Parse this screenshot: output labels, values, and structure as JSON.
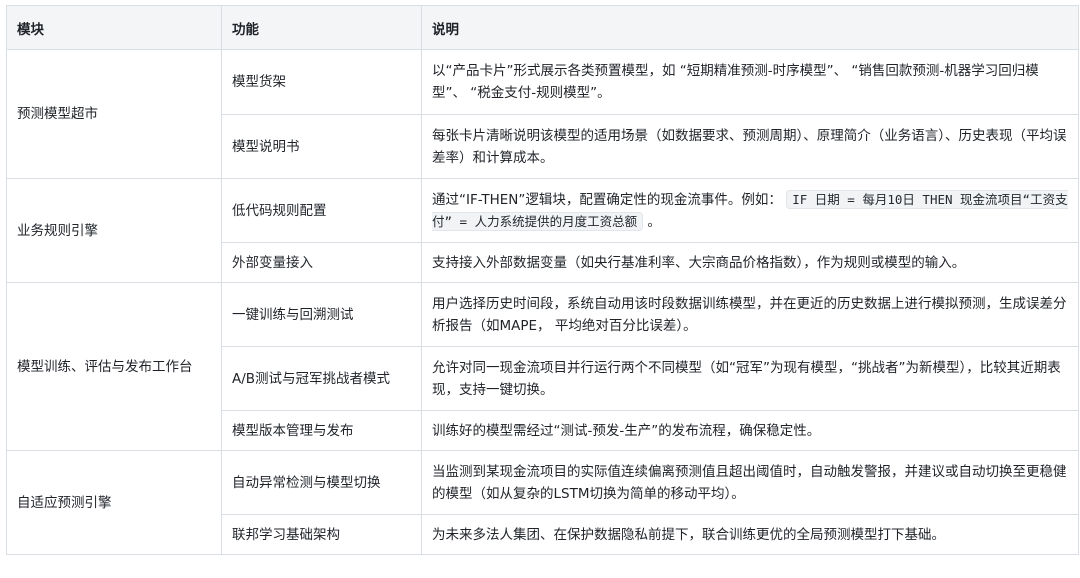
{
  "headers": [
    "模块",
    "功能",
    "说明"
  ],
  "rows": [
    {
      "module": "预测模型超市",
      "items": [
        {
          "feature": "模型货架",
          "desc": "以“产品卡片”形式展示各类预置模型，如 “短期精准预测-时序模型”、 “销售回款预测-机器学习回归模型”、 “税金支付-规则模型”。"
        },
        {
          "feature": "模型说明书",
          "desc": "每张卡片清晰说明该模型的适用场景（如数据要求、预测周期）、原理简介（业务语言）、历史表现（平均误差率）和计算成本。"
        }
      ]
    },
    {
      "module": "业务规则引擎",
      "items": [
        {
          "feature": "低代码规则配置",
          "desc_pre": "通过“IF-THEN”逻辑块，配置确定性的现金流事件。例如：",
          "desc_code": "IF 日期 = 每月10日 THEN 现金流项目“工资支付” = 人力系统提供的月度工资总额",
          "desc_post": "。"
        },
        {
          "feature": "外部变量接入",
          "desc": "支持接入外部数据变量（如央行基准利率、大宗商品价格指数），作为规则或模型的输入。"
        }
      ]
    },
    {
      "module": "模型训练、评估与发布工作台",
      "items": [
        {
          "feature": "一键训练与回溯测试",
          "desc": "用户选择历史时间段，系统自动用该时段数据训练模型，并在更近的历史数据上进行模拟预测，生成误差分析报告（如MAPE， 平均绝对百分比误差）。"
        },
        {
          "feature": "A/B测试与冠军挑战者模式",
          "desc": "允许对同一现金流项目并行运行两个不同模型（如“冠军”为现有模型，“挑战者”为新模型），比较其近期表现，支持一键切换。"
        },
        {
          "feature": "模型版本管理与发布",
          "desc": "训练好的模型需经过“测试-预发-生产”的发布流程，确保稳定性。"
        }
      ]
    },
    {
      "module": "自适应预测引擎",
      "items": [
        {
          "feature": "自动异常检测与模型切换",
          "desc": "当监测到某现金流项目的实际值连续偏离预测值且超出阈值时，自动触发警报，并建议或自动切换至更稳健的模型（如从复杂的LSTM切换为简单的移动平均）。"
        },
        {
          "feature": "联邦学习基础架构",
          "desc": "为未来多法人集团、在保护数据隐私前提下，联合训练更优的全局预测模型打下基础。"
        }
      ]
    }
  ]
}
